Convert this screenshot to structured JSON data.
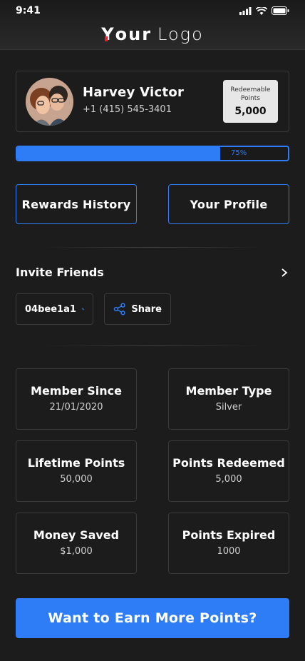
{
  "status_bar": {
    "time": "9:41"
  },
  "header": {
    "logo_first": "Y",
    "logo_rest": "our",
    "logo_second": "Logo"
  },
  "profile": {
    "name": "Harvey Victor",
    "phone": "+1 (415) 545-3401",
    "points_label": "Redeemable Points",
    "points_value": "5,000"
  },
  "progress": {
    "value": 0.75,
    "label": "75%"
  },
  "actions": {
    "rewards_history": "Rewards History",
    "your_profile": "Your Profile"
  },
  "invite": {
    "title": "Invite Friends",
    "code": "04bee1a1",
    "share_label": "Share"
  },
  "stats": [
    {
      "title": "Member Since",
      "value": "21/01/2020"
    },
    {
      "title": "Member Type",
      "value": "Silver"
    },
    {
      "title": "Lifetime Points",
      "value": "50,000"
    },
    {
      "title": "Points Redeemed",
      "value": "5,000"
    },
    {
      "title": "Money Saved",
      "value": "$1,000"
    },
    {
      "title": "Points Expired",
      "value": "1000"
    }
  ],
  "cta": {
    "label": "Want to Earn More Points?"
  },
  "colors": {
    "accent": "#2f7df6",
    "background": "#1c1c1c",
    "logo_mark": "#e3252b"
  }
}
